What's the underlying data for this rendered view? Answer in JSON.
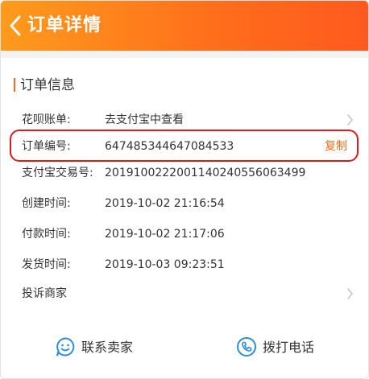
{
  "header": {
    "title": "订单详情",
    "accent": "#ff6d1b"
  },
  "section": {
    "title": "订单信息"
  },
  "rows": [
    {
      "label": "花呗账单:",
      "value": "去支付宝中查看",
      "has_chevron": true
    },
    {
      "label": "订单编号:",
      "value": "647485344647084533",
      "action": "复制"
    },
    {
      "label": "支付宝交易号:",
      "value": "2019100222001140240556063499"
    },
    {
      "label": "创建时间:",
      "value": "2019-10-02 21:16:54"
    },
    {
      "label": "付款时间:",
      "value": "2019-10-02 21:17:06"
    },
    {
      "label": "发货时间:",
      "value": "2019-10-03 09:23:51"
    },
    {
      "label": "投诉商家",
      "value": "",
      "has_chevron": true
    }
  ],
  "bottom": {
    "contact_seller": "联系卖家",
    "call_phone": "拨打电话",
    "icon_color": "#2e8bd8"
  },
  "colors": {
    "highlight": "#e11b1b",
    "copy": "#ff6a1a"
  }
}
